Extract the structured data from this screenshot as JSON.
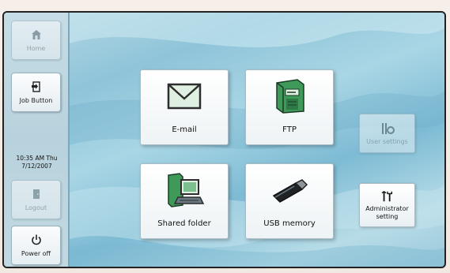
{
  "sidebar": {
    "home_label": "Home",
    "job_button_label": "Job Button",
    "clock_time": "10:35 AM Thu",
    "clock_date": "7/12/2007",
    "logout_label": "Logout",
    "power_off_label": "Power off"
  },
  "main": {
    "tiles": {
      "email": "E-mail",
      "ftp": "FTP",
      "shared_folder": "Shared folder",
      "usb_memory": "USB memory"
    },
    "right": {
      "user_settings": "User settings",
      "admin_line1": "Administrator",
      "admin_line2": "setting"
    }
  },
  "colors": {
    "accent_green": "#3f9a5a",
    "background_blue": "#8fc4d9"
  }
}
